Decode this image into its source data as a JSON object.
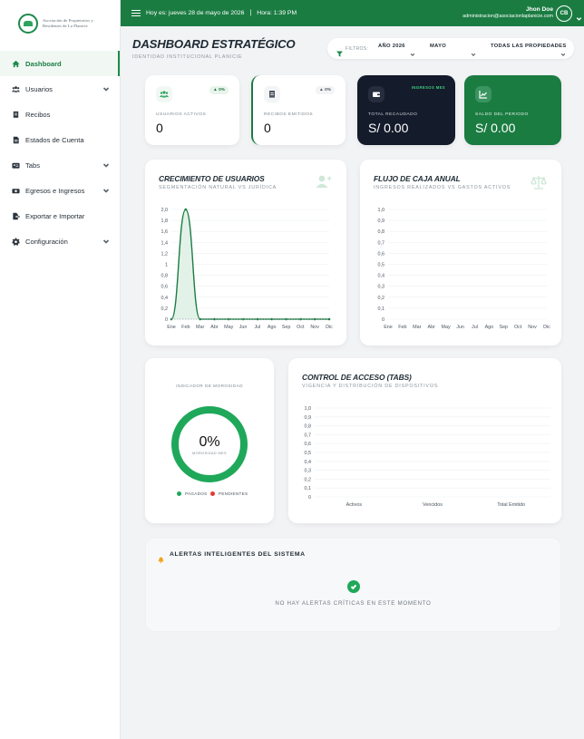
{
  "brand": {
    "name_line1": "Asociación de Propietarios y",
    "name_line2": "Residentes de La Planicie",
    "accent": "#1b7c42"
  },
  "sidebar": {
    "items": [
      {
        "label": "Dashboard",
        "icon": "home-icon",
        "active": true
      },
      {
        "label": "Usuarios",
        "icon": "users-icon",
        "expandable": true
      },
      {
        "label": "Recibos",
        "icon": "receipt-icon"
      },
      {
        "label": "Estados de Cuenta",
        "icon": "document-icon"
      },
      {
        "label": "Tabs",
        "icon": "id-card-icon",
        "expandable": true
      },
      {
        "label": "Egresos e Ingresos",
        "icon": "money-icon",
        "expandable": true
      },
      {
        "label": "Exportar e Importar",
        "icon": "file-export-icon"
      },
      {
        "label": "Configuración",
        "icon": "gear-icon",
        "expandable": true
      }
    ]
  },
  "topbar": {
    "date": "Hoy es: jueves 28 de mayo de 2026",
    "separator": "|",
    "time": "Hora: 1:39 PM",
    "user_name": "Jhon Doe",
    "user_email": "administracion@asociacionlaplanicie.com",
    "avatar_initials": "CB"
  },
  "header": {
    "title": "DASHBOARD ESTRATÉGICO",
    "subtitle": "IDENTIDAD INSTITUCIONAL PLANICIE"
  },
  "filters": {
    "label": "FILTROS:",
    "year": "AÑO 2026",
    "month": "MAYO",
    "property": "TODAS LAS PROPIEDADES"
  },
  "kpis": {
    "users": {
      "label": "USUARIOS ACTIVOS",
      "value": "0",
      "badge": "▲ 0%"
    },
    "receipts": {
      "label": "RECIBOS EMITIDOS",
      "value": "0",
      "badge": "▲ 0%"
    },
    "collected": {
      "label": "TOTAL RECAUDADO",
      "value": "S/ 0.00",
      "badge": "INGRESOS MES"
    },
    "balance": {
      "label": "SALDO DEL PERIODO",
      "value": "S/ 0.00"
    }
  },
  "charts": {
    "growth": {
      "title": "CRECIMIENTO DE USUARIOS",
      "subtitle": "SEGMENTACIÓN NATURAL VS JURÍDICA"
    },
    "cashflow": {
      "title": "FLUJO DE CAJA ANUAL",
      "subtitle": "INGRESOS REALIZADOS VS GASTOS ACTIVOS"
    },
    "access": {
      "title": "CONTROL DE ACCESO (TABS)",
      "subtitle": "VIGENCIA Y DISTRIBUCIÓN DE DISPOSITIVOS"
    }
  },
  "delinquency": {
    "title": "INDICADOR DE MOROSIDAD",
    "value": "0%",
    "sublabel": "MOROSIDAD MES",
    "legend_paid": "PAGADOS",
    "legend_pending": "PENDIENTES",
    "paid_color": "#1fa85a",
    "pending_color": "#e53935"
  },
  "alerts": {
    "title": "ALERTAS INTELIGENTES DEL SISTEMA",
    "message": "NO HAY ALERTAS CRÍTICAS EN ESTE MOMENTO"
  },
  "chart_data": [
    {
      "type": "area",
      "categories": [
        "Ene",
        "Feb",
        "Mar",
        "Abr",
        "May",
        "Jun",
        "Jul",
        "Ago",
        "Sep",
        "Oct",
        "Nov",
        "Dic"
      ],
      "series": [
        {
          "values": [
            0,
            2,
            0,
            0,
            0,
            0,
            0,
            0,
            0,
            0,
            0,
            0
          ],
          "color": "#1b7c42"
        },
        {
          "values": [
            0,
            0,
            0,
            0,
            0,
            0,
            0,
            0,
            0,
            0,
            0,
            0
          ],
          "color": "#9aa5ae"
        }
      ],
      "yticks": [
        "0",
        "0,2",
        "0,4",
        "0,6",
        "0,8",
        "1",
        "1,2",
        "1,4",
        "1,6",
        "1,8",
        "2,0"
      ],
      "ylim": [
        0,
        2
      ]
    },
    {
      "type": "line",
      "categories": [
        "Ene",
        "Feb",
        "Mar",
        "Abr",
        "May",
        "Jun",
        "Jul",
        "Ago",
        "Sep",
        "Oct",
        "Nov",
        "Dic"
      ],
      "series": [],
      "yticks": [
        "0",
        "0,1",
        "0,2",
        "0,3",
        "0,4",
        "0,5",
        "0,6",
        "0,7",
        "0,8",
        "0,9",
        "1,0"
      ],
      "ylim": [
        0,
        1
      ]
    },
    {
      "type": "bar",
      "categories": [
        "Activos",
        "Vencidos",
        "Total Emitido"
      ],
      "series": [],
      "yticks": [
        "0",
        "0,1",
        "0,2",
        "0,3",
        "0,4",
        "0,5",
        "0,6",
        "0,7",
        "0,8",
        "0,9",
        "1,0"
      ],
      "ylim": [
        0,
        1
      ]
    }
  ]
}
